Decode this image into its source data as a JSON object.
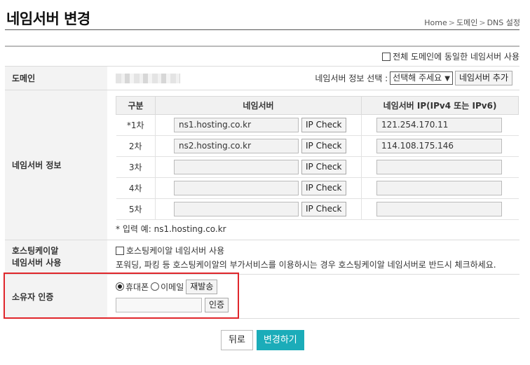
{
  "header": {
    "title": "네임서버 변경",
    "breadcrumb": [
      "Home",
      "도메인",
      "DNS 설정"
    ]
  },
  "form": {
    "apply_all_label": "전체 도메인에 동일한 네임서버 사용",
    "domain": {
      "label": "도메인",
      "select_prompt": "네임서버 정보 선택 :",
      "select_value": "선택해 주세요",
      "add_button": "네임서버 추가"
    },
    "nameservers": {
      "label": "네임서버 정보",
      "headers": [
        "구분",
        "네임서버",
        "네임서버 IP(IPv4 또는 IPv6)"
      ],
      "check_button": "IP Check",
      "rows": [
        {
          "num": "*1차",
          "ns": "ns1.hosting.co.kr",
          "ip": "121.254.170.11"
        },
        {
          "num": "2차",
          "ns": "ns2.hosting.co.kr",
          "ip": "114.108.175.146"
        },
        {
          "num": "3차",
          "ns": "",
          "ip": ""
        },
        {
          "num": "4차",
          "ns": "",
          "ip": ""
        },
        {
          "num": "5차",
          "ns": "",
          "ip": ""
        }
      ],
      "hint": "* 입력 예: ns1.hosting.co.kr"
    },
    "hosting": {
      "label_line1": "호스팅케이알",
      "label_line2": "네임서버 사용",
      "checkbox_label": "호스팅케이알 네임서버 사용",
      "note": "포워딩, 파킹 등 호스팅케이알의 부가서비스를 이용하시는 경우 호스팅케이알 네임서버로 반드시 체크하세요."
    },
    "owner": {
      "label": "소유자 인증",
      "radio_phone": "휴대폰",
      "radio_email": "이메일",
      "resend_button": "재발송",
      "verify_button": "인증"
    }
  },
  "actions": {
    "back": "뒤로",
    "submit": "변경하기"
  },
  "colors": {
    "accent": "#1bacb9",
    "highlight": "#e0262b"
  }
}
